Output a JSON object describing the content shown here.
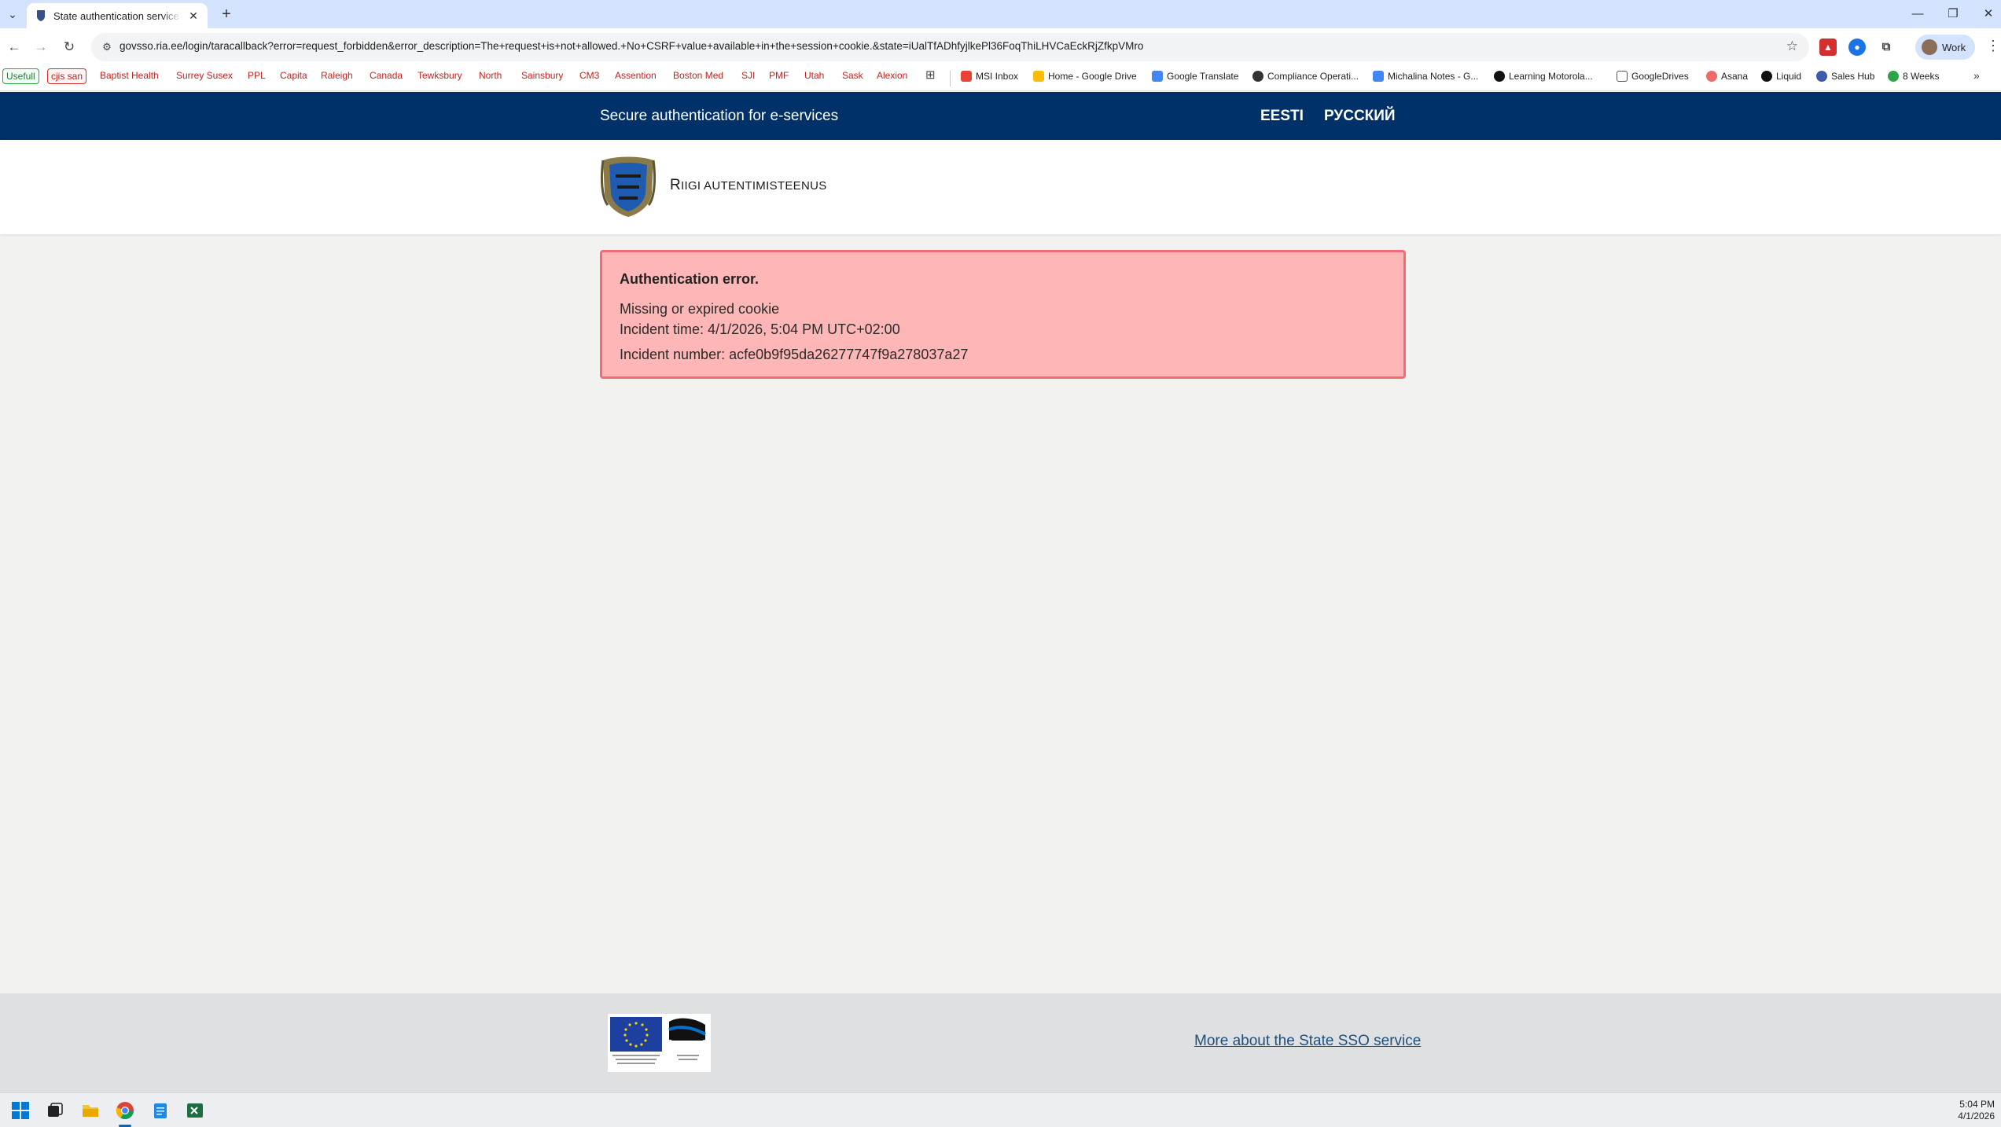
{
  "browser": {
    "tab_title": "State authentication service - S",
    "url_host": "govsso.ria.ee",
    "url_rest": "/login/taracallback?error=request_forbidden&error_description=The+request+is+not+allowed.+No+CSRF+value+available+in+the+session+cookie.&state=iUalTfADhfyjlkePl36FoqThiLHVCaEckRjZfkpVMro",
    "profile_label": "Work",
    "bookmarks": {
      "usefull": "Usefull",
      "cjis_san": "cjis san",
      "baptist_health": "Baptist Health",
      "surrey_susex": "Surrey Susex",
      "ppl": "PPL",
      "capita": "Capita",
      "raleigh": "Raleigh",
      "canada": "Canada",
      "tewksbury": "Tewksbury",
      "north": "North",
      "sainsbury": "Sainsbury",
      "cm3": "CM3",
      "assention": "Assention",
      "boston_med": "Boston Med",
      "sji": "SJI",
      "pmf": "PMF",
      "utah": "Utah",
      "sask": "Sask",
      "alexion": "Alexion",
      "msi_inbox": "MSI Inbox",
      "home_google_drive": "Home - Google Drive",
      "google_translate": "Google Translate",
      "compliance": "Compliance Operati...",
      "michalina": "Michalina Notes - G...",
      "learning": "Learning Motorola...",
      "googledrives": "GoogleDrives",
      "asana": "Asana",
      "liquid": "Liquid",
      "sales_hub": "Sales Hub",
      "eight_weeks": "8 Weeks"
    }
  },
  "header": {
    "title": "Secure authentication for e-services",
    "lang_et": "EESTI",
    "lang_ru": "РУССКИЙ"
  },
  "brand": {
    "first_letter": "R",
    "rest": "iigi autentimisteenus"
  },
  "error": {
    "title": "Authentication error.",
    "message": "Missing or expired cookie",
    "incident_time": "Incident time: 4/1/2026, 5:04 PM UTC+02:00",
    "incident_number": "Incident number: acfe0b9f95da26277747f9a278037a27"
  },
  "footer": {
    "link": "More about the State SSO service"
  },
  "taskbar": {
    "time": "5:04 PM",
    "date": "4/1/2026"
  },
  "colors": {
    "header_bg": "#003168",
    "error_bg": "#ffb6b6",
    "error_border": "#f06b74",
    "footer_link": "#1f4e79"
  }
}
